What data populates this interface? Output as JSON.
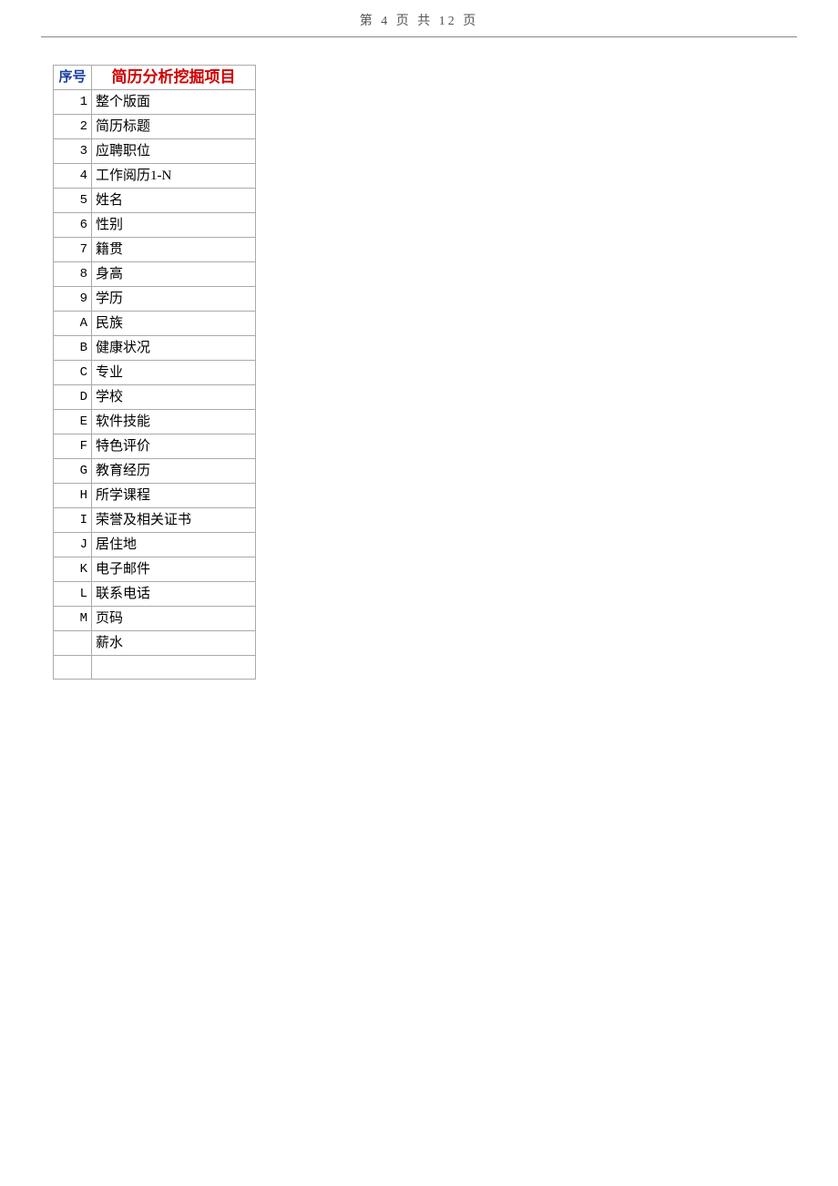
{
  "header": {
    "text": "第 4 页 共 12 页"
  },
  "table": {
    "headers": {
      "seq": "序号",
      "item": "简历分析挖掘项目"
    },
    "rows": [
      {
        "seq": "1",
        "item": "整个版面"
      },
      {
        "seq": "2",
        "item": "简历标题"
      },
      {
        "seq": "3",
        "item": "应聘职位"
      },
      {
        "seq": "4",
        "item": "工作阅历1-N"
      },
      {
        "seq": "5",
        "item": "姓名"
      },
      {
        "seq": "6",
        "item": "性别"
      },
      {
        "seq": "7",
        "item": "籍贯"
      },
      {
        "seq": "8",
        "item": "身高"
      },
      {
        "seq": "9",
        "item": "学历"
      },
      {
        "seq": "A",
        "item": "民族"
      },
      {
        "seq": "B",
        "item": "健康状况"
      },
      {
        "seq": "C",
        "item": "专业"
      },
      {
        "seq": "D",
        "item": "学校"
      },
      {
        "seq": "E",
        "item": "软件技能"
      },
      {
        "seq": "F",
        "item": "特色评价"
      },
      {
        "seq": "G",
        "item": "教育经历"
      },
      {
        "seq": "H",
        "item": "所学课程"
      },
      {
        "seq": "I",
        "item": "荣誉及相关证书"
      },
      {
        "seq": "J",
        "item": "居住地"
      },
      {
        "seq": "K",
        "item": "电子邮件"
      },
      {
        "seq": "L",
        "item": "联系电话"
      },
      {
        "seq": "M",
        "item": "页码"
      },
      {
        "seq": "",
        "item": "薪水"
      },
      {
        "seq": "",
        "item": ""
      }
    ]
  }
}
